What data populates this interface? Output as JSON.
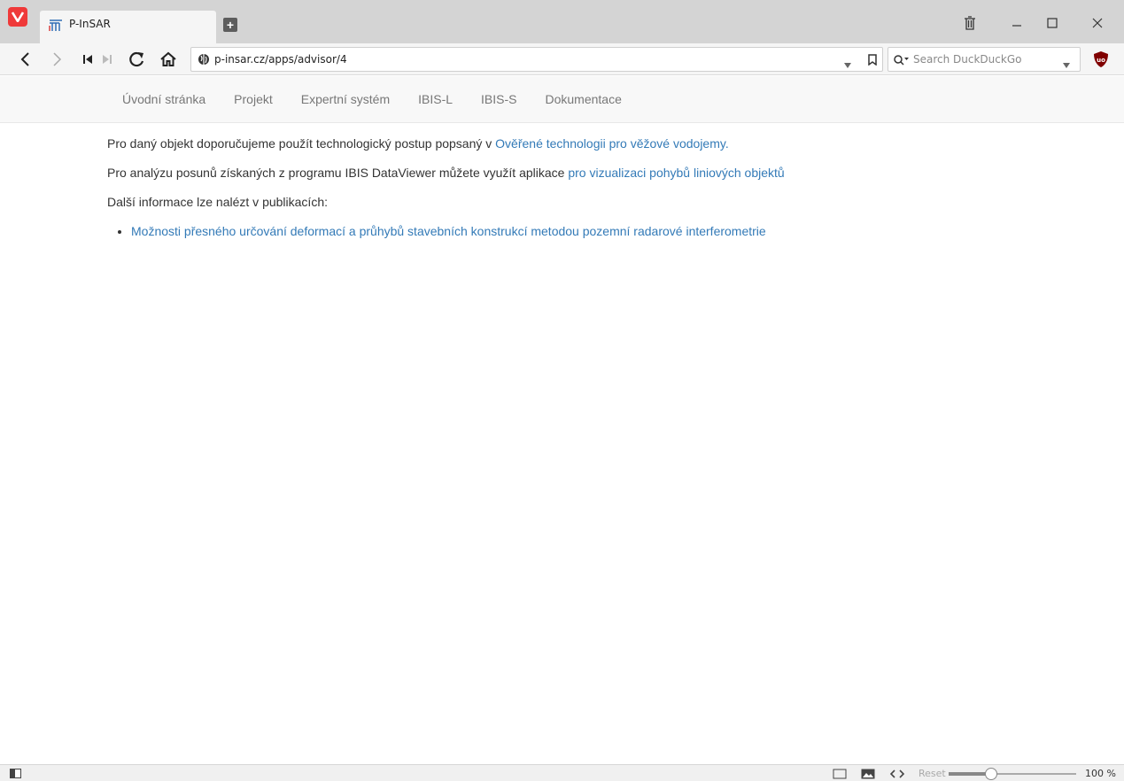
{
  "browser": {
    "tab_title": "P-InSAR",
    "url": "p-insar.cz/apps/advisor/4",
    "search_placeholder": "Search DuckDuckGo",
    "zoom_reset": "Reset",
    "zoom_level": "100 %",
    "zoom_fraction": 0.33,
    "accent": "#ef3939"
  },
  "nav": {
    "items": [
      "Úvodní stránka",
      "Projekt",
      "Expertní systém",
      "IBIS-L",
      "IBIS-S",
      "Dokumentace"
    ]
  },
  "content": {
    "p1_text": "Pro daný objekt doporučujeme použít technologický postup popsaný v ",
    "p1_link": "Ověřené technologii pro věžové vodojemy",
    "p1_suffix": ".",
    "p2_text": "Pro analýzu posunů získaných z programu IBIS DataViewer můžete využít aplikace ",
    "p2_link": "pro vizualizaci pohybů liniových objektů",
    "p3_text": "Další informace lze nalézt v publikacích:",
    "publications": [
      "Možnosti přesného určování deformací a průhybů stavebních konstrukcí metodou pozemní radarové interferometrie"
    ]
  }
}
